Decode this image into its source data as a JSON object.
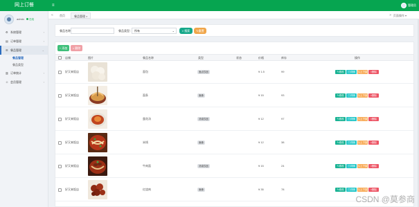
{
  "header": {
    "brand": "网上订餐",
    "menu_icon": "hamburger-icon",
    "user_label": "管理员"
  },
  "sidebar": {
    "profile_name": "admin",
    "status": "在线",
    "items": [
      {
        "icon": "gear-icon",
        "label": "系统管理"
      },
      {
        "icon": "cart-icon",
        "label": "订单管理"
      },
      {
        "icon": "list-icon",
        "label": "餐品管理",
        "active": true,
        "children": [
          "餐品管理",
          "餐品类型"
        ]
      },
      {
        "icon": "chart-icon",
        "label": "订单统计"
      },
      {
        "icon": "user-icon",
        "label": "会员管理"
      }
    ]
  },
  "tabs": {
    "home": "首页",
    "current": "餐品管理",
    "close": "×",
    "ops": "页面操作"
  },
  "search": {
    "name_label": "餐品名称：",
    "name_value": "",
    "type_label": "餐品类型：",
    "type_value": "所有",
    "search_btn": "搜索",
    "reset_btn": "重置"
  },
  "toolbar": {
    "add_btn": "+ 添加",
    "delete_btn": "× 删除"
  },
  "table": {
    "columns": [
      "店铺",
      "图片",
      "餐品名称",
      "类型",
      "状态",
      "价格",
      "库存",
      "操作"
    ],
    "actions": [
      "修改",
      "详情",
      "上下架",
      "删除"
    ],
    "rows": [
      {
        "shop": "好又来饭店",
        "name": "面包",
        "type": "面点饮品",
        "status": "",
        "price": "¥ 1.5",
        "stock": "99"
      },
      {
        "shop": "好又来饭店",
        "name": "面条",
        "type": "面食",
        "status": "",
        "price": "¥ 15",
        "stock": "93"
      },
      {
        "shop": "好又来饭店",
        "name": "蛋花汤",
        "type": "汤羹饮品",
        "status": "",
        "price": "¥ 12",
        "stock": "97"
      },
      {
        "shop": "好又来饭店",
        "name": "米线",
        "type": "面食",
        "status": "",
        "price": "¥ 12",
        "stock": "38"
      },
      {
        "shop": "好又来饭店",
        "name": "牛肉面",
        "type": "汤羹饮品",
        "status": "",
        "price": "¥ 15",
        "stock": "24"
      },
      {
        "shop": "好又来饭店",
        "name": "红烧肉",
        "type": "面食",
        "status": "",
        "price": "¥ 35",
        "stock": "78"
      }
    ]
  },
  "watermark": "CSDN @莫参商",
  "colors": {
    "brand_green": "#06a550",
    "search_btn": "#16a88a",
    "reset_btn": "#f0a64a",
    "add_btn": "#3fbf7a",
    "delete_btn": "#f0a0a6",
    "action_edit": "#1ab394",
    "action_detail": "#23c6c8",
    "action_shelf": "#f8ac59",
    "action_delete": "#ed5565"
  }
}
